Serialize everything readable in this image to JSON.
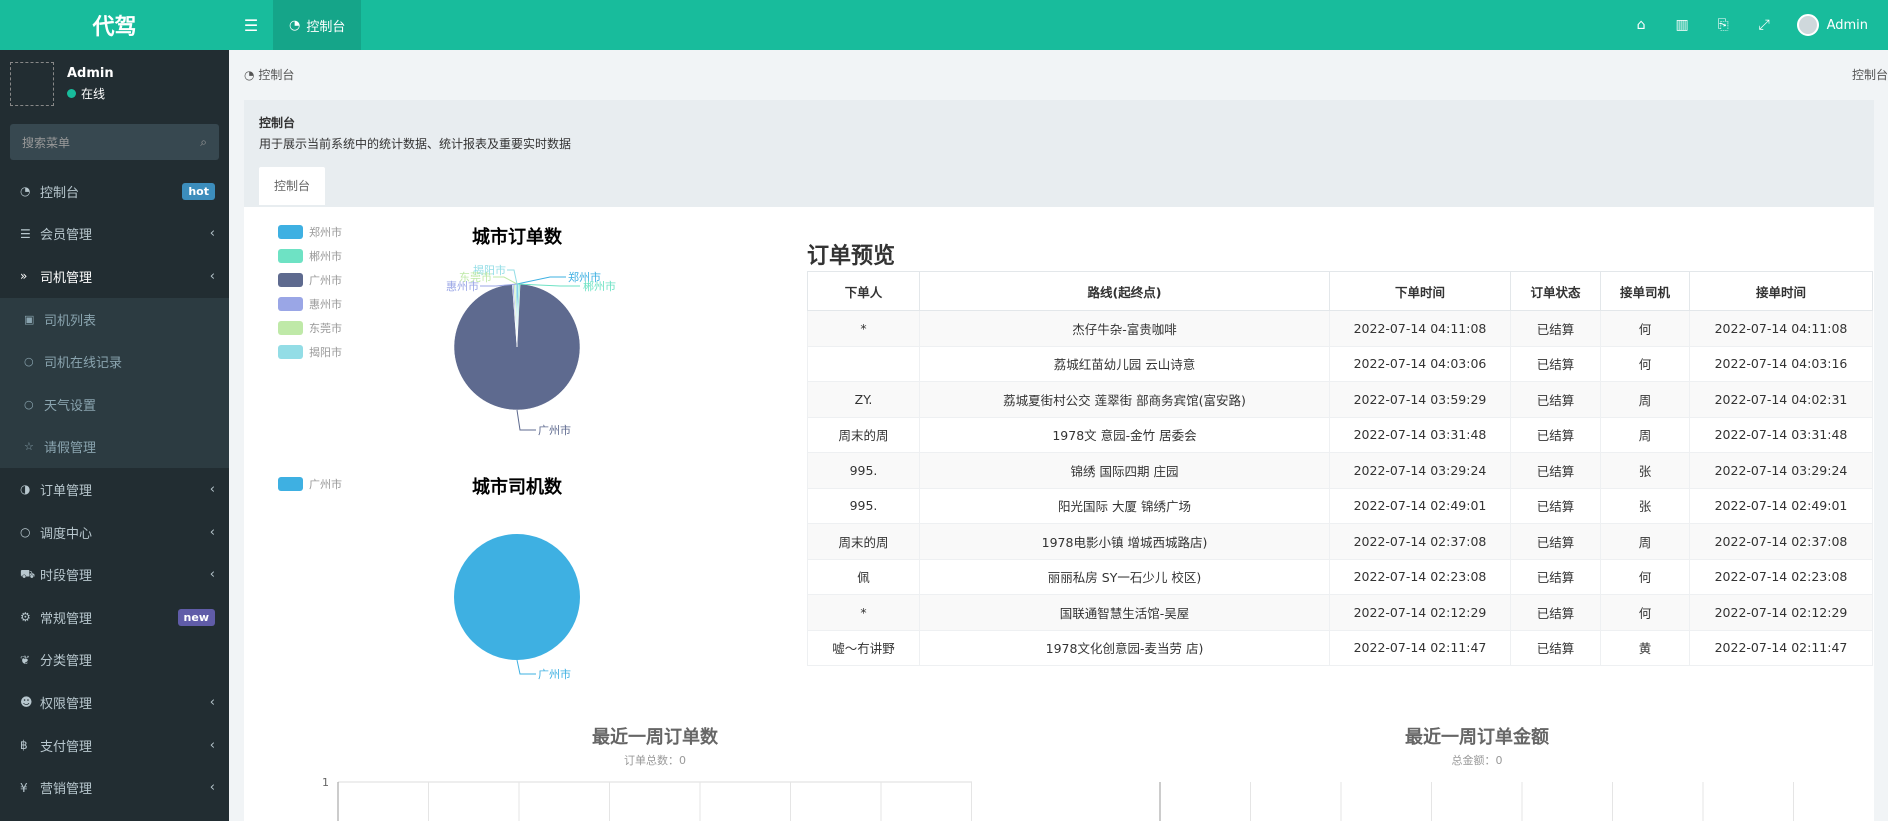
{
  "app": {
    "logo": "代驾"
  },
  "topbar": {
    "tab_label": "控制台",
    "user_name": "Admin"
  },
  "sidebar": {
    "user": {
      "name": "Admin",
      "status": "在线"
    },
    "search_placeholder": "搜索菜单",
    "items": [
      {
        "label": "控制台",
        "badge": "hot"
      },
      {
        "label": "会员管理"
      },
      {
        "label": "司机管理"
      },
      {
        "label": "订单管理"
      },
      {
        "label": "调度中心"
      },
      {
        "label": "时段管理"
      },
      {
        "label": "常规管理",
        "badge": "new"
      },
      {
        "label": "分类管理"
      },
      {
        "label": "权限管理"
      },
      {
        "label": "支付管理"
      },
      {
        "label": "营销管理"
      }
    ],
    "sub_items": [
      "司机列表",
      "司机在线记录",
      "天气设置",
      "请假管理"
    ]
  },
  "breadcrumb": {
    "left": "控制台",
    "right": "控制台"
  },
  "panel": {
    "title": "控制台",
    "desc": "用于展示当前系统中的统计数据、统计报表及重要实时数据",
    "tab": "控制台"
  },
  "colors": {
    "brand": "#18bc9c",
    "sidebar_bg": "#222d32",
    "pie_guangzhou": "#5e6a8f",
    "pie_driver": "#3eb0e2"
  },
  "chart_data": [
    {
      "type": "pie",
      "title": "城市订单数",
      "legend": [
        {
          "name": "郑州市",
          "color": "#3eb0e2"
        },
        {
          "name": "郴州市",
          "color": "#6ee2c4"
        },
        {
          "name": "广州市",
          "color": "#5e6a8f"
        },
        {
          "name": "惠州市",
          "color": "#9aa6e6"
        },
        {
          "name": "东莞市",
          "color": "#bfe9a8"
        },
        {
          "name": "揭阳市",
          "color": "#93dde6"
        }
      ],
      "slice_labels": [
        "揭阳市",
        "东莞市",
        "惠州市",
        "郑州市",
        "郴州市",
        "广州市"
      ],
      "values": [
        {
          "name": "郑州市",
          "value": 0.4
        },
        {
          "name": "郴州市",
          "value": 0.4
        },
        {
          "name": "广州市",
          "value": 99
        },
        {
          "name": "惠州市",
          "value": 0.4
        },
        {
          "name": "东莞市",
          "value": 0.4
        },
        {
          "name": "揭阳市",
          "value": 0.4
        }
      ]
    },
    {
      "type": "pie",
      "title": "城市司机数",
      "legend": [
        {
          "name": "广州市",
          "color": "#3eb0e2"
        }
      ],
      "values": [
        {
          "name": "广州市",
          "value": 100
        }
      ],
      "slice_labels": [
        "广州市"
      ]
    },
    {
      "type": "line",
      "title": "最近一周订单数",
      "subtitle": "订单总数：0",
      "y_tick": "1"
    },
    {
      "type": "line",
      "title": "最近一周订单金额",
      "subtitle": "总金额：0"
    }
  ],
  "orders": {
    "title": "订单预览",
    "columns": [
      "下单人",
      "路线(起终点)",
      "下单时间",
      "订单状态",
      "接单司机",
      "接单时间"
    ],
    "rows": [
      [
        "*",
        "杰仔牛杂-富贵咖啡",
        "2022-07-14 04:11:08",
        "已结算",
        "何",
        "2022-07-14 04:11:08"
      ],
      [
        "",
        "荔城红苗幼儿园 云山诗意",
        "2022-07-14 04:03:06",
        "已结算",
        "何",
        "2022-07-14 04:03:16"
      ],
      [
        "ZY.",
        "荔城夏街村公交 莲翠街 部商务宾馆(富安路)",
        "2022-07-14 03:59:29",
        "已结算",
        "周",
        "2022-07-14 04:02:31"
      ],
      [
        "周末的周",
        "1978文 意园-金竹 居委会",
        "2022-07-14 03:31:48",
        "已结算",
        "周",
        "2022-07-14 03:31:48"
      ],
      [
        "995.",
        "锦绣 国际四期 庄园",
        "2022-07-14 03:29:24",
        "已结算",
        "张",
        "2022-07-14 03:29:24"
      ],
      [
        "995.",
        "阳光国际 大厦 锦绣广场",
        "2022-07-14 02:49:01",
        "已结算",
        "张",
        "2022-07-14 02:49:01"
      ],
      [
        "周末的周",
        "1978电影小镇 增城西城路店)",
        "2022-07-14 02:37:08",
        "已结算",
        "周",
        "2022-07-14 02:37:08"
      ],
      [
        "佩",
        "丽丽私房 SY一石少儿 校区)",
        "2022-07-14 02:23:08",
        "已结算",
        "何",
        "2022-07-14 02:23:08"
      ],
      [
        "*",
        "国联通智慧生活馆-吴屋",
        "2022-07-14 02:12:29",
        "已结算",
        "何",
        "2022-07-14 02:12:29"
      ],
      [
        "嘘～冇讲野",
        "1978文化创意园-麦当劳 店)",
        "2022-07-14 02:11:47",
        "已结算",
        "黄",
        "2022-07-14 02:11:47"
      ]
    ]
  }
}
